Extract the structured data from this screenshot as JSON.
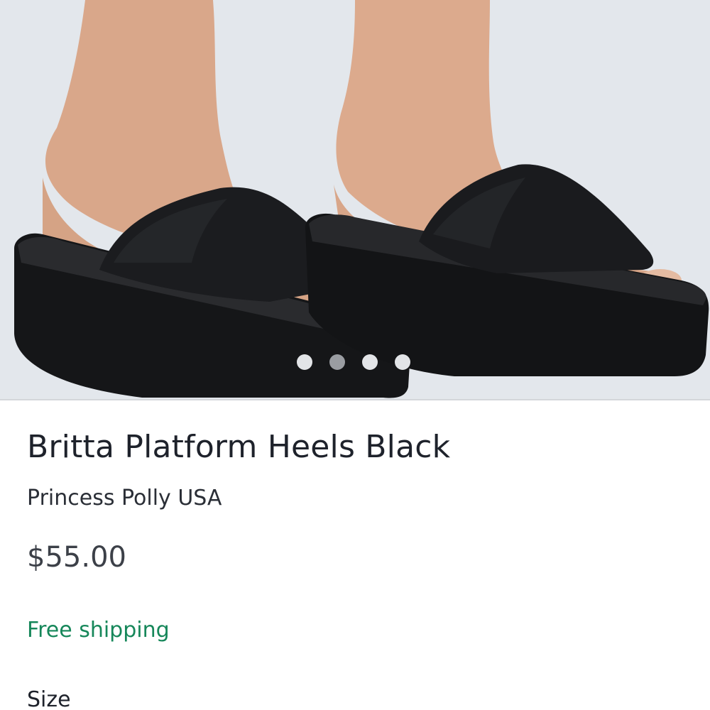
{
  "product": {
    "title": "Britta Platform Heels Black",
    "seller": "Princess Polly USA",
    "price": "$55.00",
    "shipping": "Free shipping",
    "size_label": "Size"
  },
  "gallery": {
    "image_label": "product-photo",
    "dot_count": 4,
    "active_dot_index": 1
  },
  "colors": {
    "shipping_green": "#16875a",
    "title_text": "#1e222b",
    "price_text": "#3c4048",
    "active_dot": "#9a9da2",
    "inactive_dot": "#e2e4e7"
  }
}
